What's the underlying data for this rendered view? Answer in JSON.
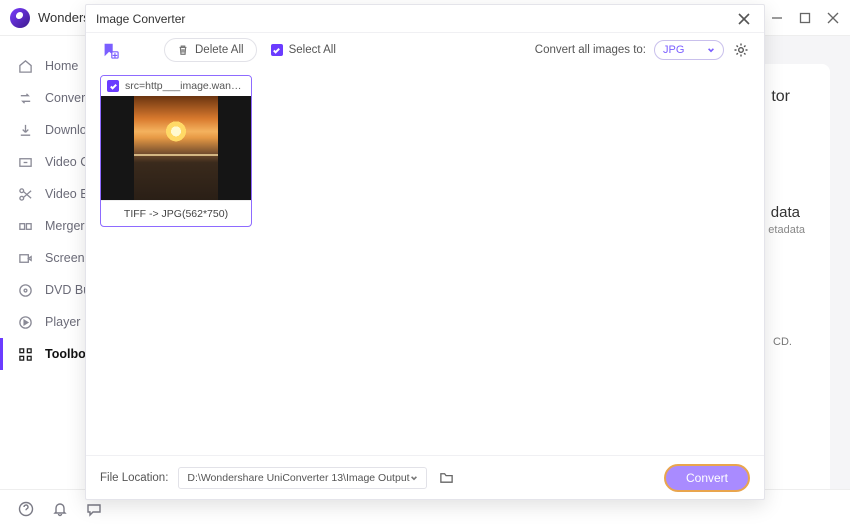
{
  "app": {
    "title": "Wondershare"
  },
  "window_controls": {
    "min": "minimize",
    "max": "maximize",
    "close": "close"
  },
  "sidebar": {
    "items": [
      {
        "label": "Home"
      },
      {
        "label": "Converter"
      },
      {
        "label": "Downloader"
      },
      {
        "label": "Video Compressor"
      },
      {
        "label": "Video Editor"
      },
      {
        "label": "Merger"
      },
      {
        "label": "Screen Recorder"
      },
      {
        "label": "DVD Burner"
      },
      {
        "label": "Player"
      },
      {
        "label": "Toolbox"
      }
    ]
  },
  "bg_content": {
    "title1_suffix": "tor",
    "title2": "data",
    "sub2": "etadata",
    "sub3": "CD."
  },
  "modal": {
    "title": "Image Converter",
    "delete_all": "Delete All",
    "select_all": "Select All",
    "convert_label": "Convert all images to:",
    "format_value": "JPG",
    "thumbs": [
      {
        "filename": "src=http___image.wangc...",
        "footer": "TIFF -> JPG(562*750)"
      }
    ],
    "file_location_label": "File Location:",
    "file_location_value": "D:\\Wondershare UniConverter 13\\Image Output",
    "convert_btn": "Convert"
  }
}
